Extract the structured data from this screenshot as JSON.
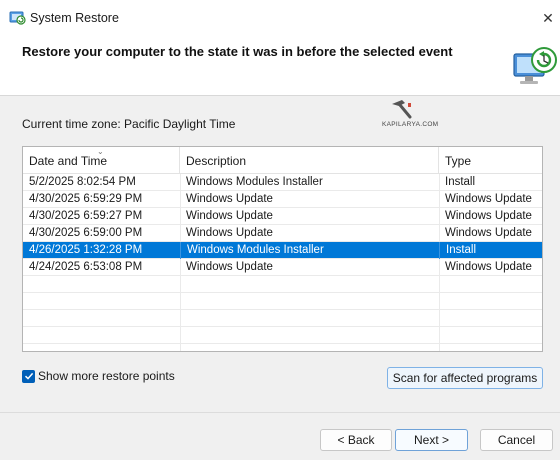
{
  "window": {
    "title": "System Restore",
    "close_glyph": "✕",
    "icon": "system-restore-icon"
  },
  "header": {
    "title": "Restore your computer to the state it was in before the selected event",
    "icon": "restore-computer-icon"
  },
  "timezone_text": "Current time zone: Pacific Daylight Time",
  "watermark": {
    "text": "KAPILARYA.COM"
  },
  "table": {
    "columns": [
      "Date and Time",
      "Description",
      "Type"
    ],
    "sort_glyph": "⌄",
    "rows": [
      {
        "date": "5/2/2025 8:02:54 PM",
        "description": "Windows Modules Installer",
        "type": "Install",
        "selected": false
      },
      {
        "date": "4/30/2025 6:59:29 PM",
        "description": "Windows Update",
        "type": "Windows Update",
        "selected": false
      },
      {
        "date": "4/30/2025 6:59:27 PM",
        "description": "Windows Update",
        "type": "Windows Update",
        "selected": false
      },
      {
        "date": "4/30/2025 6:59:00 PM",
        "description": "Windows Update",
        "type": "Windows Update",
        "selected": false
      },
      {
        "date": "4/26/2025 1:32:28 PM",
        "description": "Windows Modules Installer",
        "type": "Install",
        "selected": true
      },
      {
        "date": "4/24/2025 6:53:08 PM",
        "description": "Windows Update",
        "type": "Windows Update",
        "selected": false
      }
    ]
  },
  "show_more": {
    "label": "Show more restore points",
    "checked": true
  },
  "buttons": {
    "scan": "Scan for affected programs",
    "back": "< Back",
    "next": "Next >",
    "cancel": "Cancel"
  },
  "colors": {
    "selection": "#0078d7",
    "checkbox": "#005fb8"
  }
}
